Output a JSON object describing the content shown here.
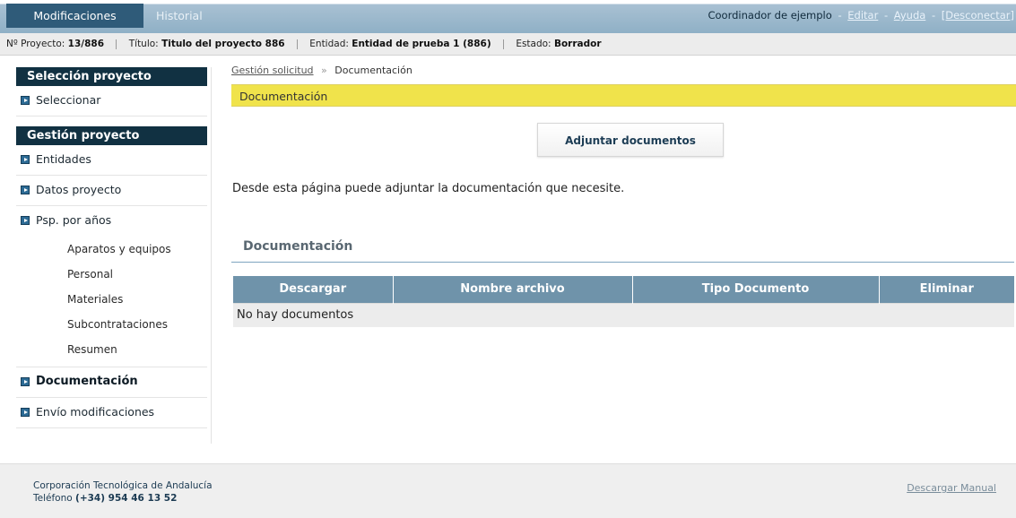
{
  "topnav": {
    "tabs": [
      {
        "label": "Modificaciones",
        "active": true
      },
      {
        "label": "Historial",
        "active": false
      }
    ],
    "user": "Coordinador de ejemplo",
    "separator": "-",
    "edit_link": "Editar",
    "help_link": "Ayuda",
    "disconnect_link": "[Desconectar]"
  },
  "infobar": {
    "project_label": "Nº Proyecto:",
    "project_value": "13/886",
    "title_label": "Título:",
    "title_value": "Titulo del proyecto 886",
    "entity_label": "Entidad:",
    "entity_value": "Entidad de prueba 1 (886)",
    "status_label": "Estado:",
    "status_value": "Borrador"
  },
  "sidebar": {
    "section1_title": "Selección proyecto",
    "select_item": "Seleccionar",
    "section2_title": "Gestión proyecto",
    "items": {
      "entidades": "Entidades",
      "datos_proyecto": "Datos proyecto",
      "psp": "Psp. por años",
      "documentacion": "Documentación",
      "envio": "Envío modificaciones"
    },
    "sub_items": [
      "Aparatos y equipos",
      "Personal",
      "Materiales",
      "Subcontrataciones",
      "Resumen"
    ]
  },
  "breadcrumb": {
    "parent": "Gestión solicitud",
    "separator": "»",
    "current": "Documentación"
  },
  "section_title": "Documentación",
  "attach_button": "Adjuntar documentos",
  "description": "Desde esta página puede adjuntar la documentación que necesite.",
  "docs": {
    "title": "Documentación",
    "columns": [
      "Descargar",
      "Nombre archivo",
      "Tipo Documento",
      "Eliminar"
    ],
    "empty_message": "No hay documentos"
  },
  "footer": {
    "org": "Corporación Tecnológica de Andalucía",
    "phone_label": "Teléfono",
    "phone": "(+34) 954 46 13 52",
    "manual_link": "Descargar Manual"
  },
  "colors": {
    "nav_active": "#2f5b79",
    "sidebar_header": "#113142",
    "section_bar": "#f0e34b",
    "table_header": "#6f93aa"
  }
}
